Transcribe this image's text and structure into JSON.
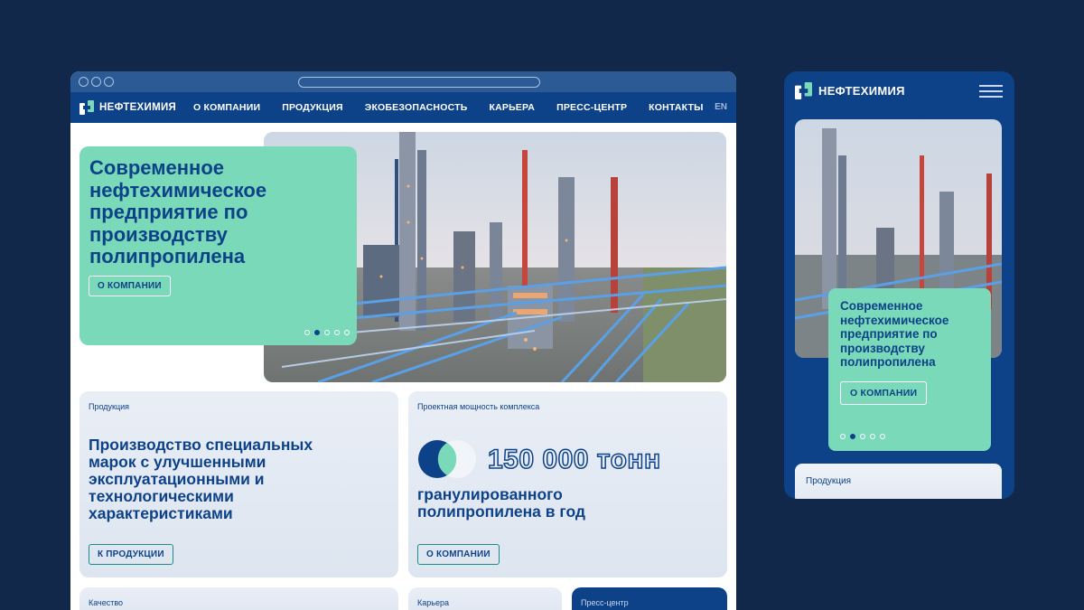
{
  "desktop": {
    "nav": {
      "brand": "НЕФТЕХИМИЯ",
      "items": [
        "О КОМПАНИИ",
        "ПРОДУКЦИЯ",
        "ЭКОБЕЗОПАСНОСТЬ",
        "КАРЬЕРА",
        "ПРЕСС-ЦЕНТР",
        "КОНТАКТЫ"
      ],
      "lang": "EN"
    },
    "hero": {
      "title": "Современное нефтехимическое предприятие по производству полипропилена",
      "button": "О КОМПАНИИ",
      "slides": 5,
      "active_slide": 2
    },
    "tiles": {
      "products": {
        "caption": "Продукция",
        "title": "Производство специальных марок с улучшенными эксплуатационными и технологическими характеристиками",
        "button": "К ПРОДУКЦИИ"
      },
      "capacity": {
        "caption": "Проектная мощность комплекса",
        "value": "150 000 тонн",
        "subtitle": "гранулированного полипропилена в год",
        "button": "О КОМПАНИИ"
      },
      "quality": {
        "caption": "Качество"
      },
      "career": {
        "caption": "Карьера"
      },
      "press": {
        "caption": "Пресс-центр"
      }
    }
  },
  "mobile": {
    "brand": "НЕФТЕХИМИЯ",
    "hero": {
      "title": "Современное нефтехимическое предприятие по производству полипропилена",
      "button": "О КОМПАНИИ",
      "slides": 5,
      "active_slide": 2
    },
    "tile_caption": "Продукция"
  },
  "colors": {
    "background": "#12284a",
    "brand_blue": "#0d4289",
    "mint": "#7ad9b8"
  }
}
